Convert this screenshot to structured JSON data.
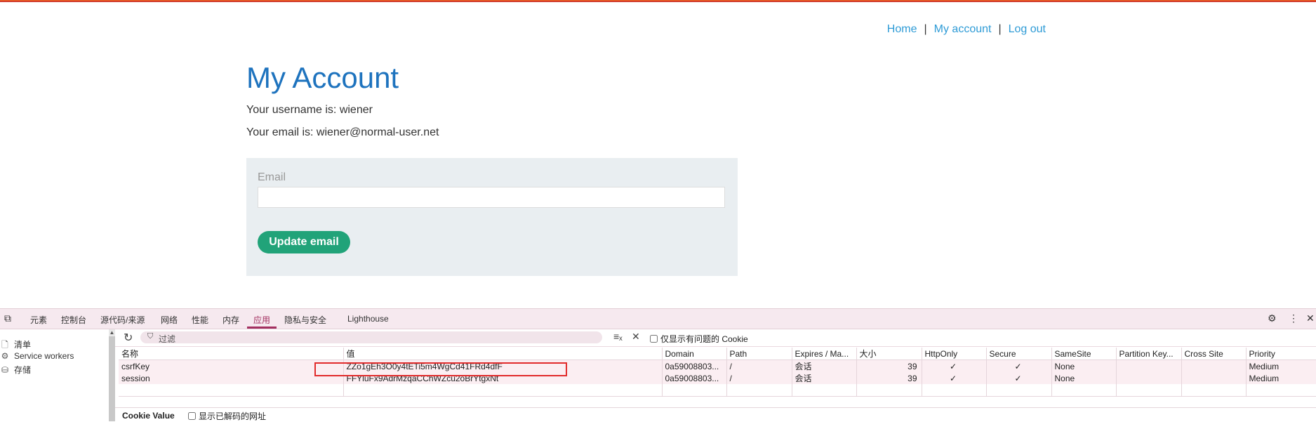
{
  "nav": {
    "home": "Home",
    "my_account": "My account",
    "log_out": "Log out",
    "separator": "|"
  },
  "page": {
    "title": "My Account",
    "username_line": "Your username is: wiener",
    "email_line": "Your email is: wiener@normal-user.net"
  },
  "form": {
    "email_label": "Email",
    "email_value": "",
    "button": "Update email"
  },
  "devtools": {
    "tabs": [
      "元素",
      "控制台",
      "源代码/来源",
      "网络",
      "性能",
      "内存",
      "应用",
      "隐私与安全",
      "Lighthouse"
    ],
    "active_tab": "应用",
    "sidebar": [
      "清单",
      "Service workers",
      "存储"
    ],
    "filter_placeholder": "过滤",
    "only_issues_label": "仅显示有问题的 Cookie",
    "columns": [
      "名称",
      "值",
      "Domain",
      "Path",
      "Expires / Ma...",
      "大小",
      "HttpOnly",
      "Secure",
      "SameSite",
      "Partition Key...",
      "Cross Site",
      "Priority"
    ],
    "rows": [
      [
        "csrfKey",
        "ZZo1gEh3O0y4tETi5m4WgCd41FRd4dfF",
        "0a59008803...",
        "/",
        "会话",
        "39",
        "✓",
        "✓",
        "None",
        "",
        "",
        "Medium"
      ],
      [
        "session",
        "FFYluFx9AdrMzqaCChWZcu2oBrYtgxNt",
        "0a59008803...",
        "/",
        "会话",
        "39",
        "✓",
        "✓",
        "None",
        "",
        "",
        "Medium"
      ]
    ],
    "cookie_value_label": "Cookie Value",
    "show_decoded_label": "显示已解码的网址"
  },
  "colors": {
    "link": "#2e9bd6",
    "title": "#1e73be",
    "button": "#21a379",
    "form_bg": "#e9eef1",
    "devtools_accent": "#a33060",
    "highlight": "#e12b2b"
  }
}
